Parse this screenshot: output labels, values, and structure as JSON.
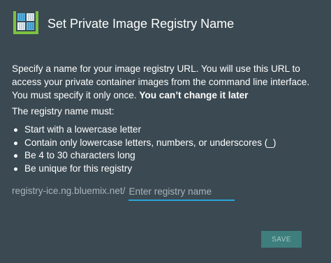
{
  "dialog": {
    "title": "Set Private Image Registry Name",
    "intro_text": "Specify a name for your image registry URL. You will use this URL to access your private container images from the command line interface. You must specify it only once.",
    "intro_warning": "You can’t change it later",
    "rules_title": "The registry name must:",
    "rules": [
      "Start with a lowercase letter",
      "Contain only lowercase letters, numbers, or underscores (_)",
      "Be 4 to 30 characters long",
      "Be unique for this registry"
    ],
    "url_prefix": "registry-ice.ng.bluemix.net/",
    "input_value": "",
    "input_placeholder": "Enter registry name",
    "save_label": "SAVE",
    "logo_icon": "container-registry-icon"
  },
  "colors": {
    "background": "#3b4a52",
    "accent": "#2aa3d6",
    "button": "#3e7f7d",
    "muted_text": "#a9b3b9"
  }
}
